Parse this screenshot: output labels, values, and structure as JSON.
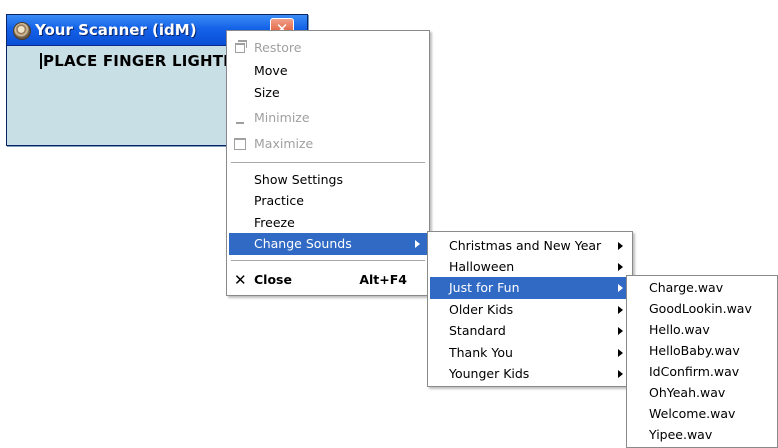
{
  "window": {
    "title": "Your Scanner (idM)",
    "close_glyph": "✕",
    "prompt": "PLACE FINGER LIGHTLY ON SCANNER"
  },
  "system_menu": {
    "items": [
      {
        "label": "Restore",
        "enabled": false,
        "icon": "restore-icon"
      },
      {
        "label": "Move",
        "enabled": true
      },
      {
        "label": "Size",
        "enabled": true
      },
      {
        "label": "Minimize",
        "enabled": false,
        "icon": "minimize-icon"
      },
      {
        "label": "Maximize",
        "enabled": false,
        "icon": "maximize-icon"
      },
      {
        "label": "Show Settings",
        "enabled": true
      },
      {
        "label": "Practice",
        "enabled": true
      },
      {
        "label": "Freeze",
        "enabled": true
      },
      {
        "label": "Change Sounds",
        "enabled": true,
        "selected": true,
        "submenu": true
      },
      {
        "label": "Close",
        "enabled": true,
        "shortcut": "Alt+F4",
        "icon": "close-icon",
        "icon_glyph": "✕"
      }
    ]
  },
  "sounds_menu": {
    "items": [
      {
        "label": "Christmas and New Year"
      },
      {
        "label": "Halloween"
      },
      {
        "label": "Just for Fun",
        "selected": true
      },
      {
        "label": "Older Kids"
      },
      {
        "label": "Standard"
      },
      {
        "label": "Thank You"
      },
      {
        "label": "Younger Kids"
      }
    ]
  },
  "files_menu": {
    "items": [
      "Charge.wav",
      "GoodLookin.wav",
      "Hello.wav",
      "HelloBaby.wav",
      "IdConfirm.wav",
      "OhYeah.wav",
      "Welcome.wav",
      "Yipee.wav"
    ]
  },
  "colors": {
    "selection": "#316ac5",
    "titlebar": "#1462e8",
    "window_body": "#c9dfe6",
    "disabled_text": "#a0a0a0"
  }
}
